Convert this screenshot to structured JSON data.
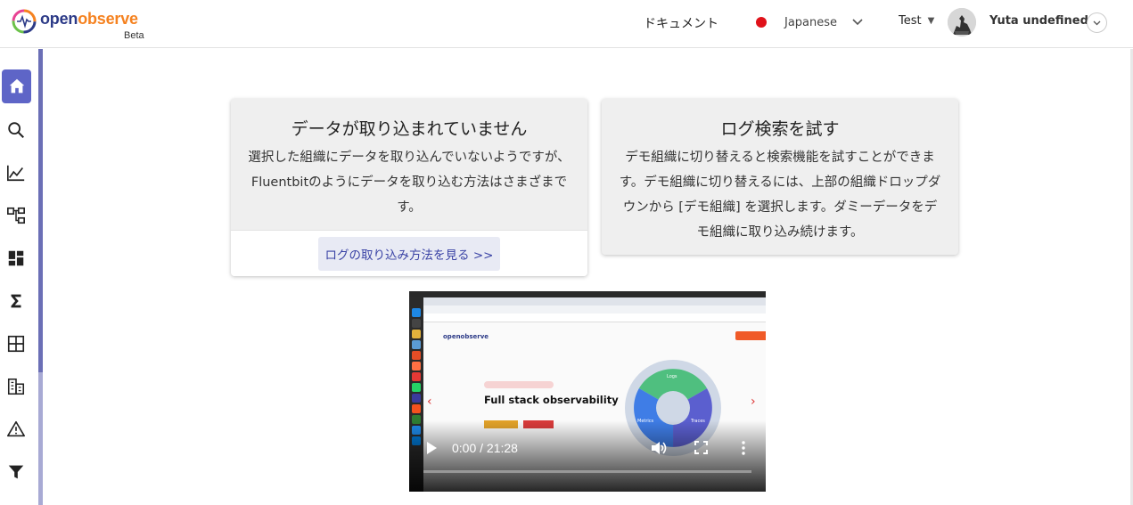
{
  "header": {
    "logo": {
      "part1": "open",
      "part2": "observe",
      "beta": "Beta"
    },
    "docs_link": "ドキュメント",
    "language": {
      "label": "Japanese",
      "flag_color": "#e0121a"
    },
    "org": {
      "label": "Test"
    },
    "user": {
      "name": "Yuta undefined"
    }
  },
  "sidebar": {
    "items": [
      {
        "name": "home",
        "icon": "home-icon",
        "active": true
      },
      {
        "name": "search",
        "icon": "search-icon"
      },
      {
        "name": "metrics",
        "icon": "line-chart-icon"
      },
      {
        "name": "traces",
        "icon": "hierarchy-icon"
      },
      {
        "name": "dashboards",
        "icon": "dashboard-icon"
      },
      {
        "name": "functions",
        "icon": "sigma-icon"
      },
      {
        "name": "streams",
        "icon": "grid-icon"
      },
      {
        "name": "reports",
        "icon": "report-icon"
      },
      {
        "name": "alerts",
        "icon": "warning-icon"
      },
      {
        "name": "pipelines",
        "icon": "filter-icon"
      }
    ],
    "accent": "#5e65c7"
  },
  "cards": {
    "no_data": {
      "title": "データが取り込まれていません",
      "body": "選択した組織にデータを取り込んでいないようですが、Fluentbitのようにデータを取り込む方法はさまざまです。",
      "cta": "ログの取り込み方法を見る >>"
    },
    "try_search": {
      "title": "ログ検索を試す",
      "body": "デモ組織に切り替えると検索機能を試すことができます。デモ組織に切り替えるには、上部の組織ドロップダウンから [デモ組織] を選択します。ダミーデータをデモ組織に取り込み続けます。"
    }
  },
  "video": {
    "time": "0:00 / 21:28",
    "progress": 0,
    "slide": {
      "brand": "openobserve",
      "title": "Full stack observability",
      "segments": [
        "Logs",
        "Metrics",
        "Traces"
      ]
    }
  }
}
